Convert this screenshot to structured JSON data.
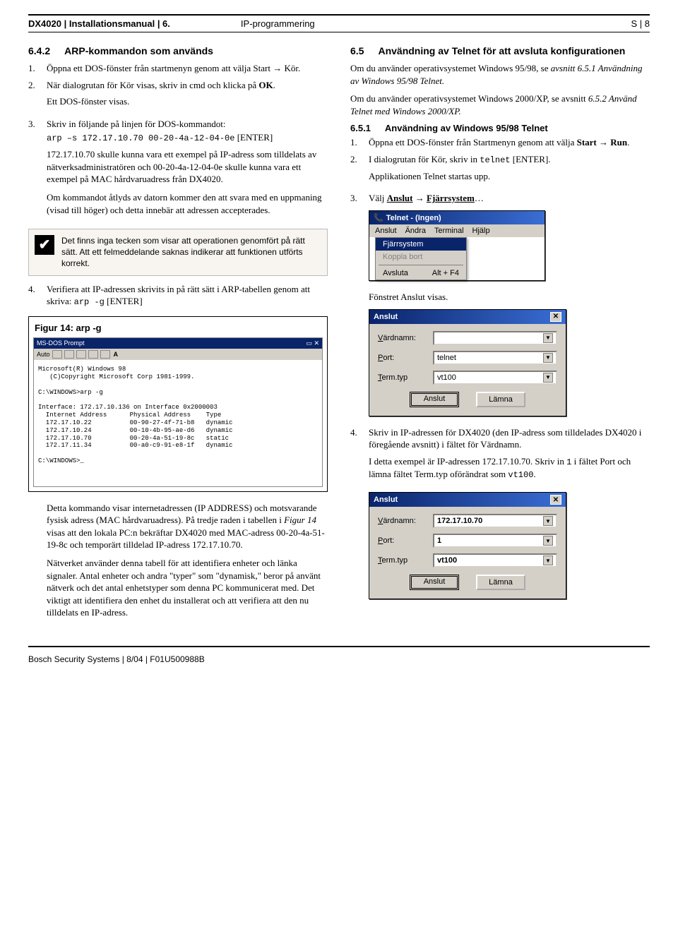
{
  "header": {
    "left": "DX4020 | Installationsmanual | 6.",
    "center": "IP-programmering",
    "right": "S | 8"
  },
  "left": {
    "sec642_num": "6.4.2",
    "sec642_title": "ARP-kommandon som används",
    "step1_num": "1.",
    "step1_body": "Öppna ett DOS-fönster från startmenyn genom att välja Start → Kör.",
    "step2_num": "2.",
    "step2_body_a": "När dialogrutan för Kör visas, skriv in cmd och klicka på ",
    "step2_body_ok": "OK",
    "step2_body_b": ".",
    "step2_sub": "Ett DOS-fönster visas.",
    "step3_num": "3.",
    "step3_body": "Skriv in följande på linjen för DOS-kommandot:",
    "step3_cmd": "arp –s 172.17.10.70 00-20-4a-12-04-0e",
    "step3_cmd_enter": " [ENTER]",
    "step3_p1": "172.17.10.70 skulle kunna vara ett exempel på IP-adress som tilldelats av nätverksadministratören och 00-20-4a-12-04-0e skulle kunna vara ett exempel på MAC hårdvaruadress från DX4020.",
    "step3_p2": "Om kommandot åtlyds av datorn kommer den att svara med en uppmaning (visad till höger) och detta innebär att adressen accepterades.",
    "note_text": "Det finns inga tecken som visar att operationen genomfört på rätt sätt. Att ett felmeddelande saknas indikerar att funktionen utförts korrekt.",
    "step4_num": "4.",
    "step4_body_a": "Verifiera att IP-adressen skrivits in på rätt sätt i ARP-tabellen genom att skriva: ",
    "step4_cmd": "arp -g",
    "step4_body_b": " [ENTER]",
    "figure_label": "Figur 14:  arp -g",
    "dos_title": "MS-DOS Prompt",
    "dos_auto": "Auto",
    "dos_body": "Microsoft(R) Windows 98\n   (C)Copyright Microsoft Corp 1981-1999.\n\nC:\\WINDOWS>arp -g\n\nInterface: 172.17.10.136 on Interface 0x2000003\n  Internet Address      Physical Address    Type\n  172.17.10.22          00-90-27-4f-71-b8   dynamic\n  172.17.10.24          00-10-4b-95-ae-d6   dynamic\n  172.17.10.70          00-20-4a-51-19-8c   static\n  172.17.11.34          00-a0-c9-91-e8-1f   dynamic\n\nC:\\WINDOWS>_",
    "p_after1_a": "Detta kommando visar internetadressen (IP ADDRESS) och motsvarande fysisk adress (MAC hårdvaruadress). På tredje raden i tabellen i ",
    "p_after1_fig": "Figur 14",
    "p_after1_b": " visas att den lokala PC:n bekräftar DX4020 med MAC-adress 00-20-4a-51-19-8c och temporärt tilldelad IP-adress 172.17.10.70.",
    "p_after2": "Nätverket använder denna tabell för att identifiera enheter och länka signaler. Antal enheter och andra \"typer\" som \"dynamisk,\" beror på använt nätverk och det antal enhetstyper som denna PC kommunicerat med. Det viktigt att identifiera den enhet du installerat och att verifiera att den nu tilldelats en IP-adress."
  },
  "right": {
    "sec65_num": "6.5",
    "sec65_title": "Användning av Telnet för att avsluta konfigurationen",
    "p1_a": "Om du använder operativsystemet Windows 95/98, se ",
    "p1_ref": "avsnitt 6.5.1 Användning av Windows 95/98 Telnet.",
    "p2_a": "Om du använder operativsystemet Windows 2000/XP, se avsnitt ",
    "p2_ref": "6.5.2 Använd  Telnet med Windows 2000/XP.",
    "sec651_num": "6.5.1",
    "sec651_title": "Användning av Windows 95/98 Telnet",
    "s1_num": "1.",
    "s1_body_a": "Öppna ett DOS-fönster från Startmenyn genom att välja ",
    "s1_body_b": "Start → Run",
    "s1_body_c": ".",
    "s2_num": "2.",
    "s2_body_a": "I dialogrutan för Kör, skriv in ",
    "s2_cmd": "telnet",
    "s2_body_b": " [ENTER].",
    "s2_sub": "Applikationen Telnet startas upp.",
    "s3_num": "3.",
    "s3_body_a": "Välj ",
    "s3_anslut": "Anslut",
    "s3_arrow": " → ",
    "s3_fjarr": "Fjärrsystem",
    "s3_dots": "…",
    "telnet1": {
      "title": "Telnet - (Ingen)",
      "menu": {
        "m1": "Anslut",
        "m2": "Ändra",
        "m3": "Terminal",
        "m4": "Hjälp"
      },
      "dd1": "Fjärrsystem",
      "dd2": "Koppla bort",
      "dd3a": "Avsluta",
      "dd3b": "Alt + F4"
    },
    "after_t1": "Fönstret Anslut visas.",
    "anslut1": {
      "title": "Anslut",
      "lbl_host": "Värdnamn:",
      "lbl_port": "Port:",
      "lbl_term": "Term.typ",
      "val_host": "",
      "val_port": "telnet",
      "val_term": "vt100",
      "btn_ok": "Anslut",
      "btn_cancel": "Lämna"
    },
    "s4_num": "4.",
    "s4_body": "Skriv in IP-adressen för DX4020 (den IP-adress som tilldelades DX4020 i föregående avsnitt) i fältet för Värdnamn.",
    "s4_sub_a": "I detta exempel är IP-adressen 172.17.10.70. Skriv in ",
    "s4_sub_one": "1",
    "s4_sub_b": " i fältet Port och lämna fältet Term.typ oförändrat som ",
    "s4_sub_vt": "vt100",
    "s4_sub_c": ".",
    "anslut2": {
      "title": "Anslut",
      "lbl_host": "Värdnamn:",
      "lbl_port": "Port:",
      "lbl_term": "Term.typ",
      "val_host": "172.17.10.70",
      "val_port": "1",
      "val_term": "vt100",
      "btn_ok": "Anslut",
      "btn_cancel": "Lämna"
    }
  },
  "footer": "Bosch Security Systems | 8/04 | F01U500988B",
  "chart_data": {
    "type": "table",
    "title": "arp -g output",
    "columns": [
      "Internet Address",
      "Physical Address",
      "Type"
    ],
    "rows": [
      [
        "172.17.10.22",
        "00-90-27-4f-71-b8",
        "dynamic"
      ],
      [
        "172.17.10.24",
        "00-10-4b-95-ae-d6",
        "dynamic"
      ],
      [
        "172.17.10.70",
        "00-20-4a-51-19-8c",
        "static"
      ],
      [
        "172.17.11.34",
        "00-a0-c9-91-e8-1f",
        "dynamic"
      ]
    ],
    "interface": "172.17.10.136 on Interface 0x2000003"
  }
}
